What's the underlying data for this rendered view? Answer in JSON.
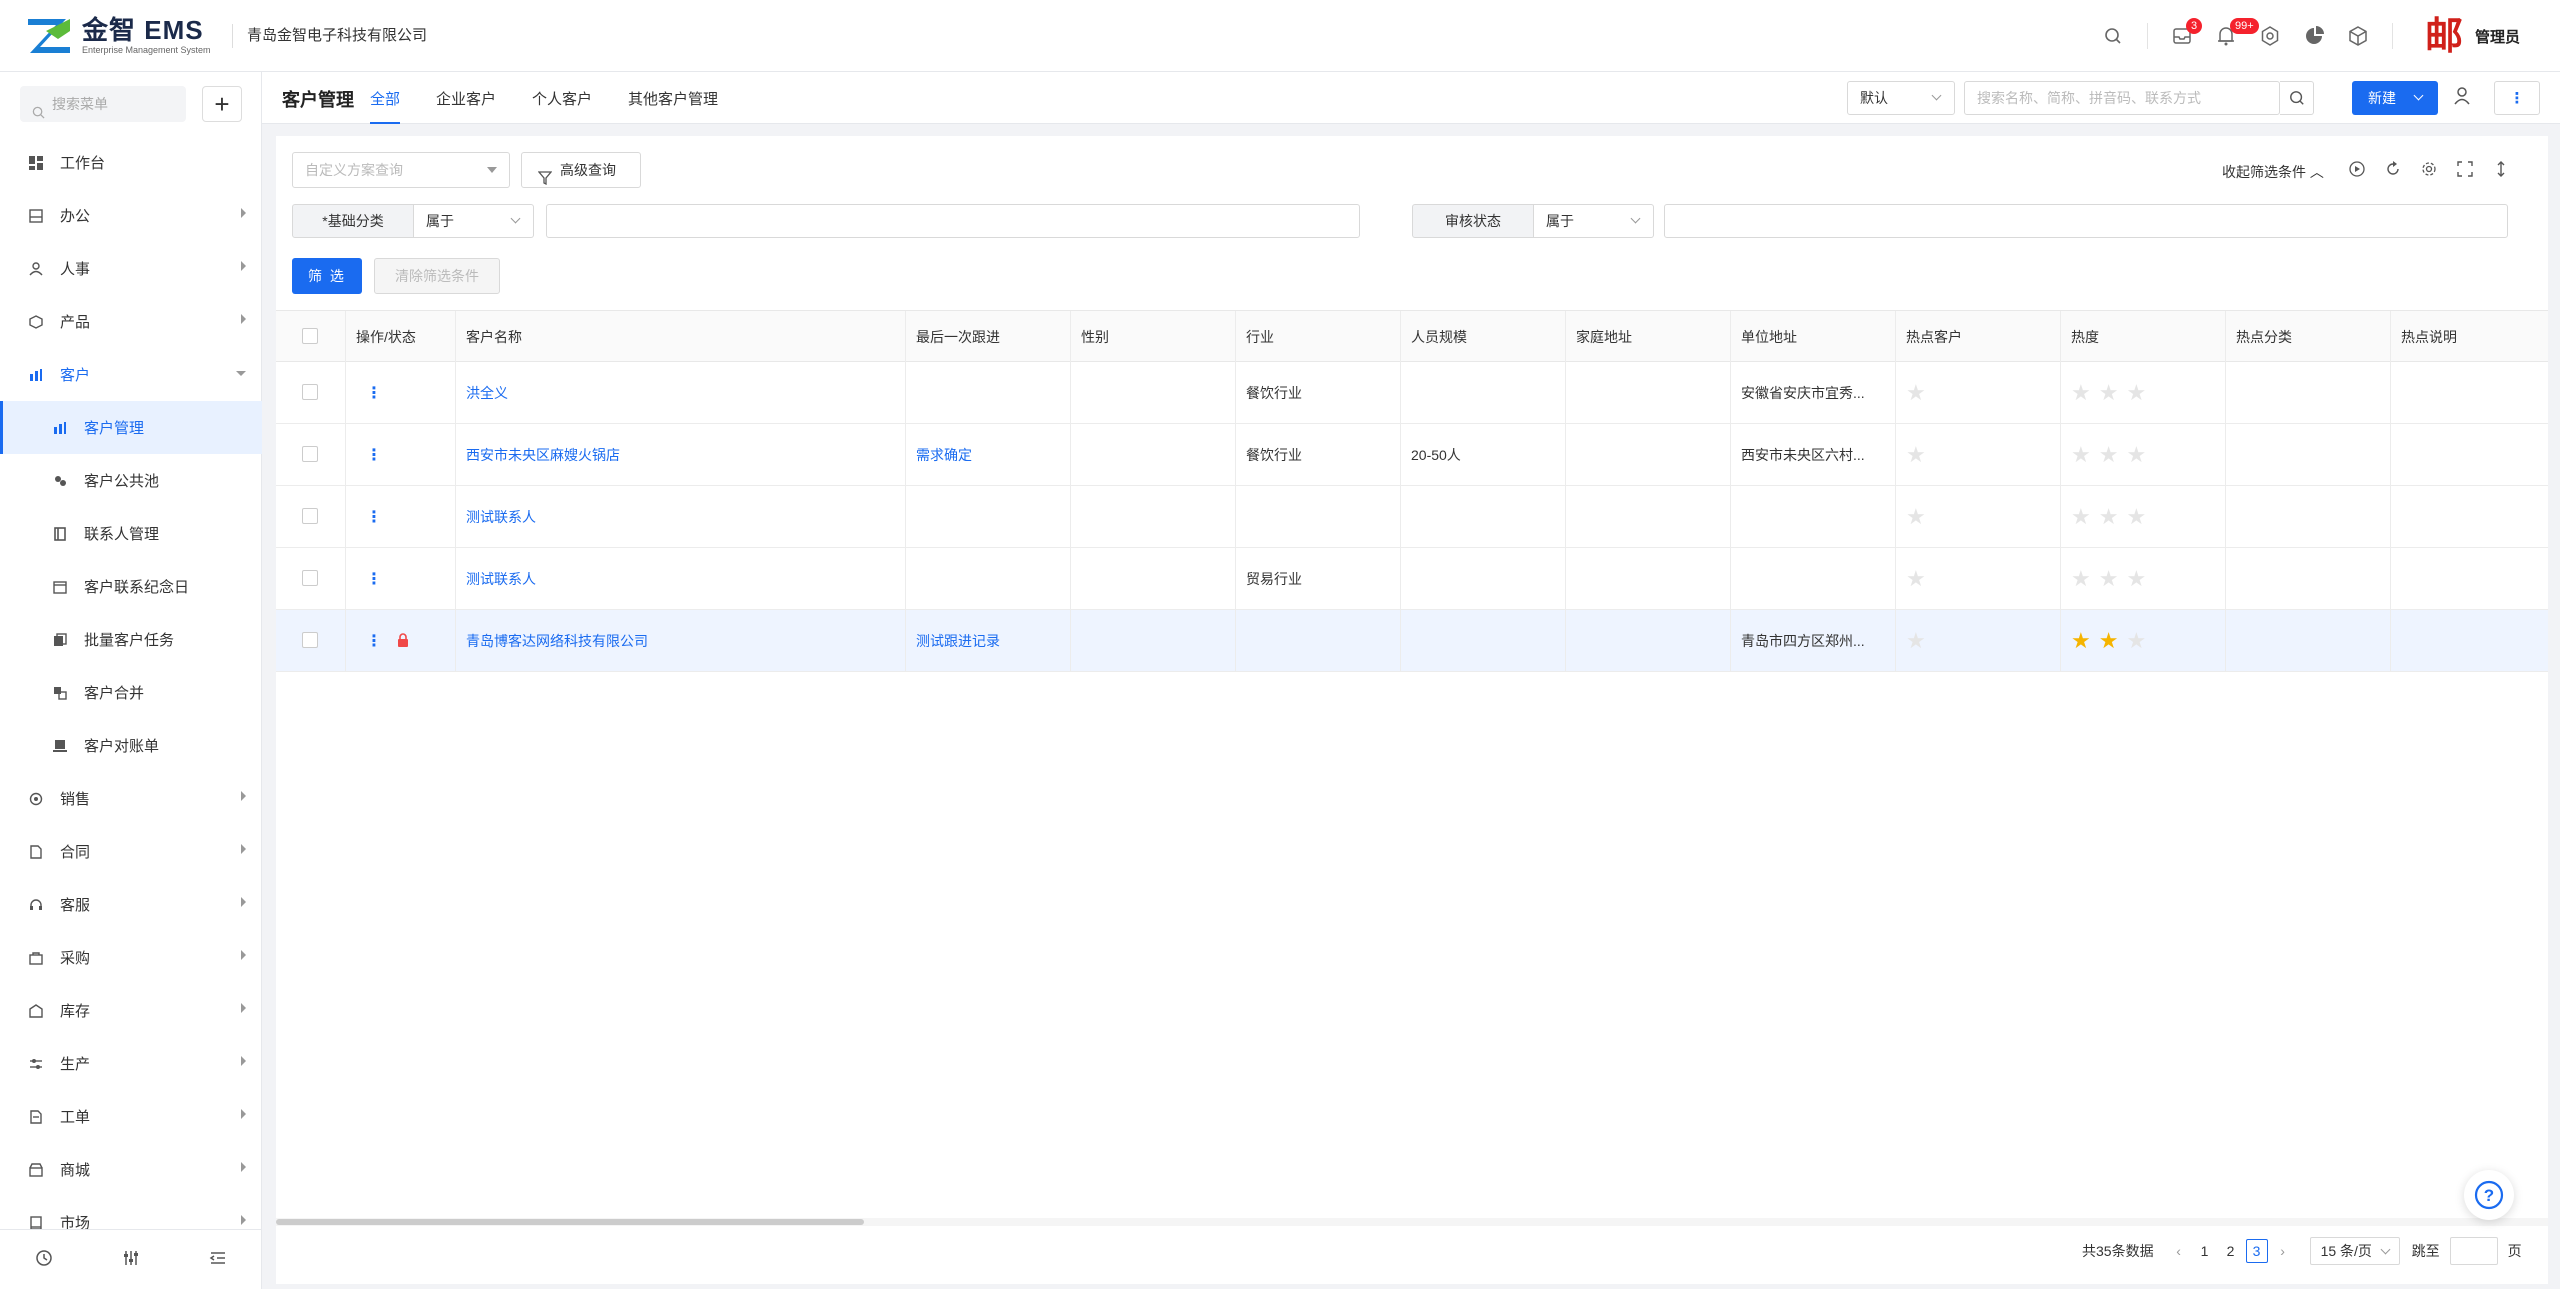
{
  "header": {
    "logo_text": "金智 EMS",
    "logo_sub": "Enterprise Management System",
    "company": "青岛金智电子科技有限公司",
    "badges": {
      "inbox": "3",
      "bell": "99+"
    },
    "user_stamp": "邮",
    "user_name": "管理员"
  },
  "sidebar": {
    "search_placeholder": "搜索菜单",
    "add": "+",
    "items": [
      {
        "label": "工作台"
      },
      {
        "label": "办公"
      },
      {
        "label": "人事"
      },
      {
        "label": "产品"
      },
      {
        "label": "客户"
      },
      {
        "label": "客户管理"
      },
      {
        "label": "客户公共池"
      },
      {
        "label": "联系人管理"
      },
      {
        "label": "客户联系纪念日"
      },
      {
        "label": "批量客户任务"
      },
      {
        "label": "客户合并"
      },
      {
        "label": "客户对账单"
      },
      {
        "label": "销售"
      },
      {
        "label": "合同"
      },
      {
        "label": "客服"
      },
      {
        "label": "采购"
      },
      {
        "label": "库存"
      },
      {
        "label": "生产"
      },
      {
        "label": "工单"
      },
      {
        "label": "商城"
      },
      {
        "label": "市场"
      }
    ]
  },
  "tabbar": {
    "title": "客户管理",
    "tabs": [
      "全部",
      "企业客户",
      "个人客户",
      "其他客户管理"
    ],
    "default_select": "默认",
    "search_placeholder": "搜索名称、简称、拼音码、联系方式",
    "new_label": "新建"
  },
  "filters": {
    "scheme_placeholder": "自定义方案查询",
    "advanced": "高级查询",
    "collapse": "收起筛选条件",
    "field1_label": "*基础分类",
    "field1_op": "属于",
    "field2_label": "审核状态",
    "field2_op": "属于",
    "filter_btn": "筛 选",
    "clear_btn": "清除筛选条件"
  },
  "table": {
    "columns": [
      "操作/状态",
      "客户名称",
      "最后一次跟进",
      "性别",
      "行业",
      "人员规模",
      "家庭地址",
      "单位地址",
      "热点客户",
      "热度",
      "热点分类",
      "热点说明"
    ],
    "rows": [
      {
        "name": "洪全义",
        "follow": "",
        "gender": "",
        "industry": "餐饮行业",
        "size": "",
        "home": "",
        "work": "安徽省安庆市宜秀...",
        "hot": false,
        "heat": 0,
        "locked": false
      },
      {
        "name": "西安市未央区麻嫂火锅店",
        "follow": "需求确定",
        "gender": "",
        "industry": "餐饮行业",
        "size": "20-50人",
        "home": "",
        "work": "西安市未央区六村...",
        "hot": false,
        "heat": 0,
        "locked": false
      },
      {
        "name": "测试联系人",
        "follow": "",
        "gender": "",
        "industry": "",
        "size": "",
        "home": "",
        "work": "",
        "hot": false,
        "heat": 0,
        "locked": false
      },
      {
        "name": "测试联系人",
        "follow": "",
        "gender": "",
        "industry": "贸易行业",
        "size": "",
        "home": "",
        "work": "",
        "hot": false,
        "heat": 0,
        "locked": false
      },
      {
        "name": "青岛博客达网络科技有限公司",
        "follow": "测试跟进记录",
        "gender": "",
        "industry": "",
        "size": "",
        "home": "",
        "work": "青岛市四方区郑州...",
        "hot": false,
        "heat": 2,
        "locked": true
      }
    ]
  },
  "pager": {
    "total": "共35条数据",
    "pages": [
      "1",
      "2",
      "3"
    ],
    "current": "3",
    "page_size": "15 条/页",
    "jump_label": "跳至",
    "page_unit": "页"
  },
  "colors": {
    "accent": "#1a6bf0",
    "star": "#f5b400",
    "badge": "#f5222d"
  }
}
